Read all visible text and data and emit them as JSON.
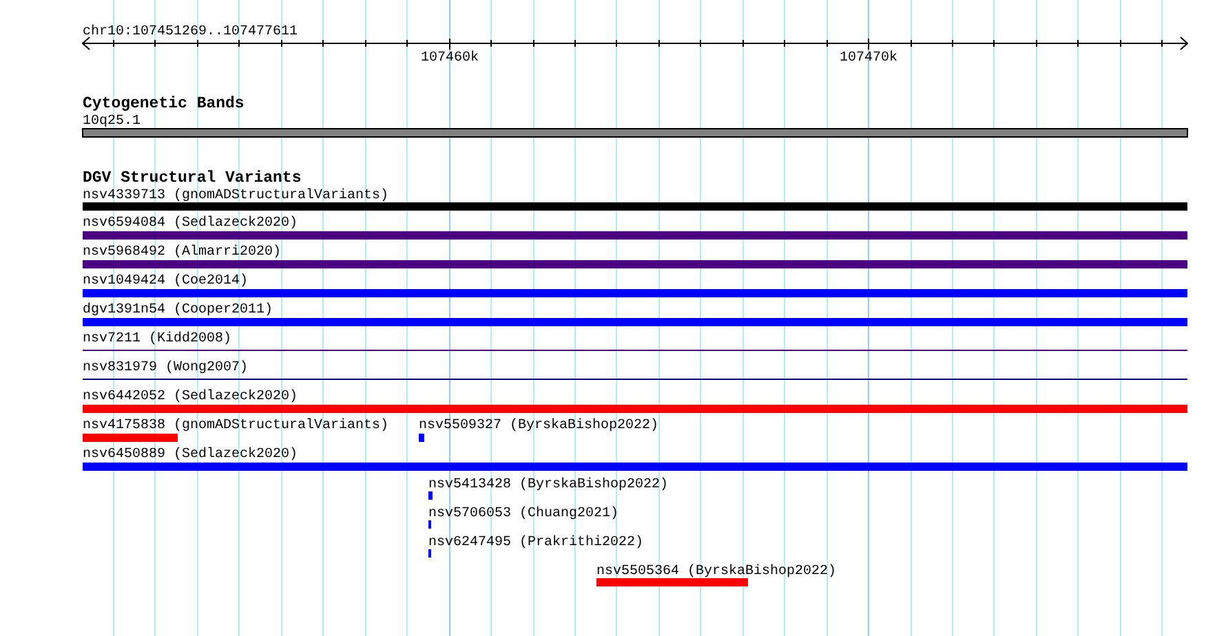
{
  "ruler": {
    "range_label": "chr10:107451269..107477611",
    "major_ticks": [
      "107460k",
      "107470k"
    ]
  },
  "cytogenetic_bands": {
    "title": "Cytogenetic Bands",
    "band_label": "10q25.1"
  },
  "dgv_track": {
    "title": "DGV Structural Variants",
    "features": [
      {
        "label": "nsv4339713 (gnomADStructuralVariants)",
        "color": "#000000",
        "kind": "thick"
      },
      {
        "label": "nsv6594084 (Sedlazeck2020)",
        "color": "#4b0082",
        "kind": "thick"
      },
      {
        "label": "nsv5968492 (Almarri2020)",
        "color": "#4b0082",
        "kind": "thick"
      },
      {
        "label": "nsv1049424 (Coe2014)",
        "color": "#0000ff",
        "kind": "thick"
      },
      {
        "label": "dgv1391n54 (Cooper2011)",
        "color": "#0000ff",
        "kind": "thick"
      },
      {
        "label": "nsv7211 (Kidd2008)",
        "color": "#4b0082",
        "kind": "thin"
      },
      {
        "label": "nsv831979 (Wong2007)",
        "color": "#00008b",
        "kind": "thin"
      },
      {
        "label": "nsv6442052 (Sedlazeck2020)",
        "color": "#ff0000",
        "kind": "thick"
      },
      {
        "label": "nsv4175838 (gnomADStructuralVariants)",
        "color": "#ff0000",
        "kind": "thick"
      },
      {
        "label": "nsv5509327 (ByrskaBishop2022)",
        "color": "#0000ff",
        "kind": "thick"
      },
      {
        "label": "nsv6450889 (Sedlazeck2020)",
        "color": "#0000ff",
        "kind": "thick"
      },
      {
        "label": "nsv5413428 (ByrskaBishop2022)",
        "color": "#0000ff",
        "kind": "thick"
      },
      {
        "label": "nsv5706053 (Chuang2021)",
        "color": "#0000ff",
        "kind": "thick"
      },
      {
        "label": "nsv6247495 (Prakrithi2022)",
        "color": "#0000ff",
        "kind": "thick"
      },
      {
        "label": "nsv5505364 (ByrskaBishop2022)",
        "color": "#ff0000",
        "kind": "thick"
      }
    ]
  }
}
